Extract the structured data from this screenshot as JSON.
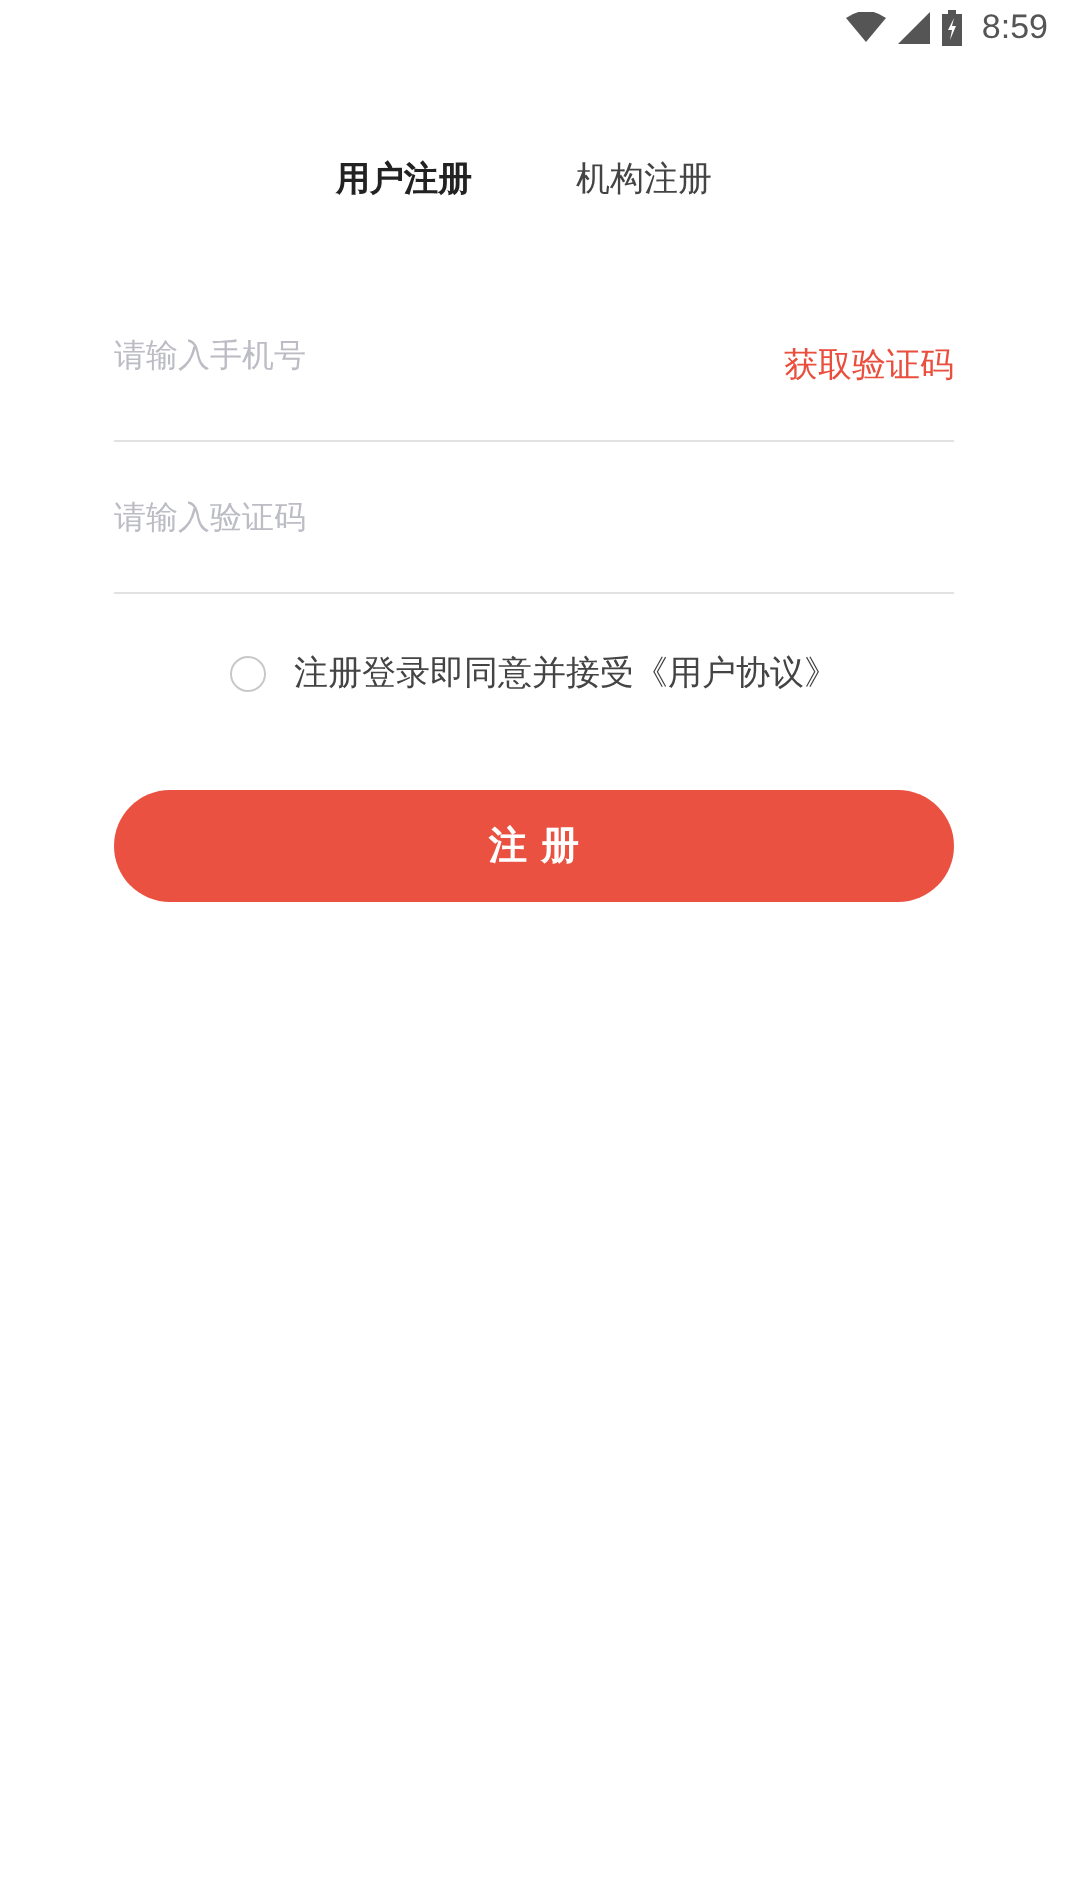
{
  "status_bar": {
    "time": "8:59"
  },
  "tabs": [
    {
      "label": "用户注册",
      "selected": true
    },
    {
      "label": "机构注册",
      "selected": false
    }
  ],
  "fields": [
    {
      "placeholder": "请输入手机号",
      "action": "获取验证码"
    },
    {
      "placeholder": "请输入验证码"
    }
  ],
  "agreement": {
    "text": "注册登录即同意并接受《用户协议》",
    "checked": false
  },
  "submit_button": "注 册"
}
